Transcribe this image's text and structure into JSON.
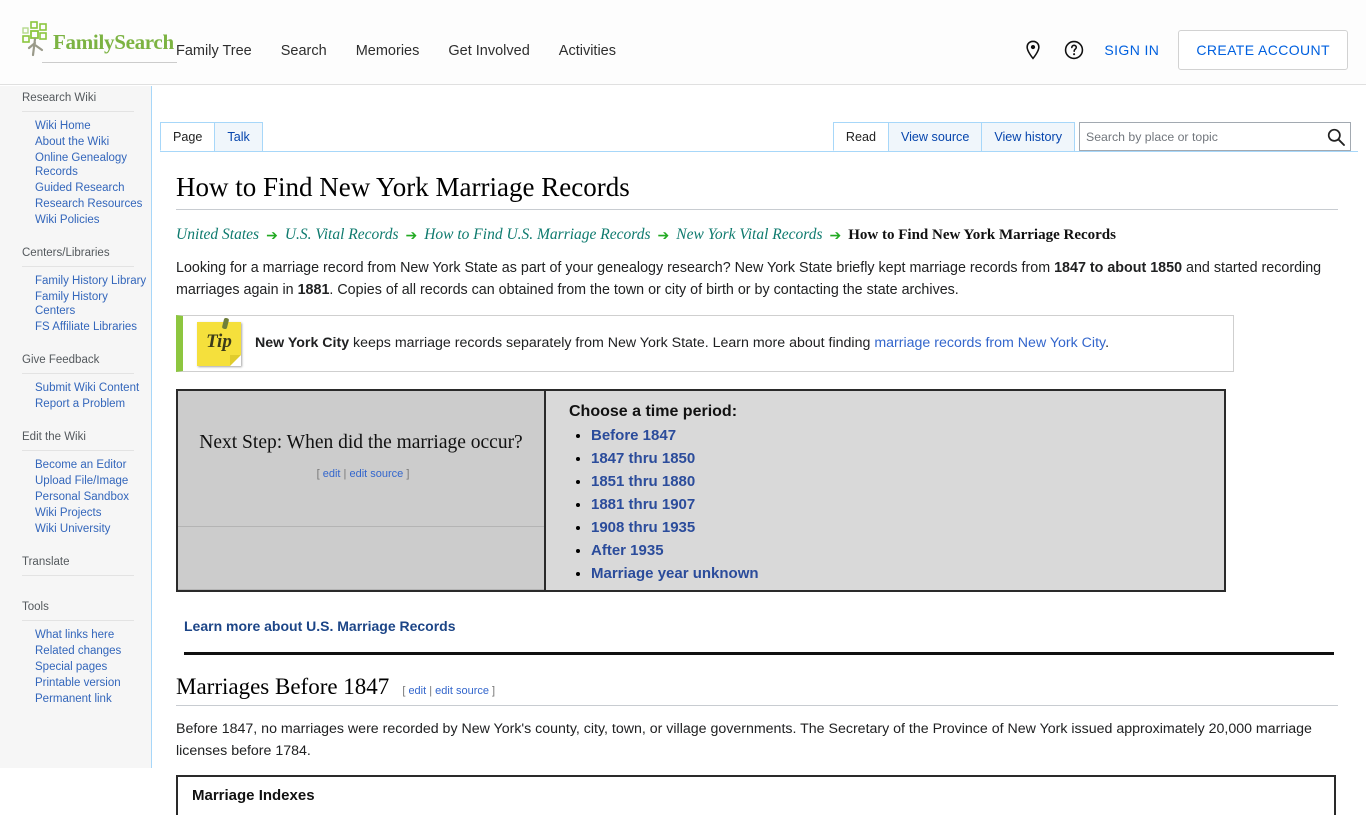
{
  "header": {
    "brand": "FamilySearch",
    "nav": [
      "Family Tree",
      "Search",
      "Memories",
      "Get Involved",
      "Activities"
    ],
    "location_icon": "location-pin-icon",
    "help_icon": "help-circle-icon",
    "sign_in": "SIGN IN",
    "create_account": "CREATE ACCOUNT",
    "brand_color": "#7cb342",
    "link_color": "#0060df"
  },
  "sidebar": {
    "groups": [
      {
        "heading": "Research Wiki",
        "items": [
          "Wiki Home",
          "About the Wiki",
          "Online Genealogy Records",
          "Guided Research",
          "Research Resources",
          "Wiki Policies"
        ]
      },
      {
        "heading": "Centers/Libraries",
        "items": [
          "Family History Library",
          "Family History Centers",
          "FS Affiliate Libraries"
        ]
      },
      {
        "heading": "Give Feedback",
        "items": [
          "Submit Wiki Content",
          "Report a Problem"
        ]
      },
      {
        "heading": "Edit the Wiki",
        "items": [
          "Become an Editor",
          "Upload File/Image",
          "Personal Sandbox",
          "Wiki Projects",
          "Wiki University"
        ]
      },
      {
        "heading": "Translate",
        "items": []
      },
      {
        "heading": "Tools",
        "items": [
          "What links here",
          "Related changes",
          "Special pages",
          "Printable version",
          "Permanent link"
        ]
      }
    ]
  },
  "tabs": {
    "left": [
      {
        "label": "Page",
        "active": true
      },
      {
        "label": "Talk",
        "active": false
      }
    ],
    "right": [
      {
        "label": "Read",
        "active": true
      },
      {
        "label": "View source",
        "active": false
      },
      {
        "label": "View history",
        "active": false
      }
    ]
  },
  "search": {
    "placeholder": "Search by place or topic",
    "value": "",
    "icon": "search-icon"
  },
  "page": {
    "title": "How to Find New York Marriage Records",
    "breadcrumb": {
      "links": [
        "United States",
        "U.S. Vital Records",
        "How to Find U.S. Marriage Records",
        "New York Vital Records"
      ],
      "current": "How to Find New York Marriage Records",
      "arrow": "➔"
    },
    "intro": {
      "part1": "Looking for a marriage record from New York State as part of your genealogy research? New York State briefly kept marriage records from ",
      "bold1": "1847 to about 1850",
      "part2": " and started recording marriages again in ",
      "bold2": "1881",
      "part3": ". Copies of all records can obtained from the town or city of birth or by contacting the state archives."
    },
    "tip": {
      "icon_word": "Tip",
      "bold": "New York City",
      "text": " keeps marriage records separately from New York State. Learn more about finding ",
      "link": "marriage records from New York City",
      "tail": ".",
      "accent_color": "#8dc63f"
    },
    "time_period_table": {
      "next_step": "Next Step: When did the marriage occur?",
      "edit_open": "[",
      "edit_label": "edit",
      "edit_divider": "|",
      "edit_source_label": "edit source",
      "edit_close": "]",
      "choose_title": "Choose a time period:",
      "options": [
        "Before 1847",
        "1847 thru 1850",
        "1851 thru 1880",
        "1881 thru 1907",
        "1908 thru 1935",
        "After 1935",
        "Marriage year unknown"
      ]
    },
    "learn_more": "Learn more about U.S. Marriage Records",
    "section": {
      "heading": "Marriages Before 1847",
      "edit_open": "[",
      "edit_label": "edit",
      "edit_divider": "|",
      "edit_source_label": "edit source",
      "edit_close": "]",
      "text": "Before 1847, no marriages were recorded by New York's county, city, town, or village governments. The Secretary of the Province of New York issued approximately 20,000 marriage licenses before 1784."
    },
    "sub_box_title": "Marriage Indexes"
  }
}
